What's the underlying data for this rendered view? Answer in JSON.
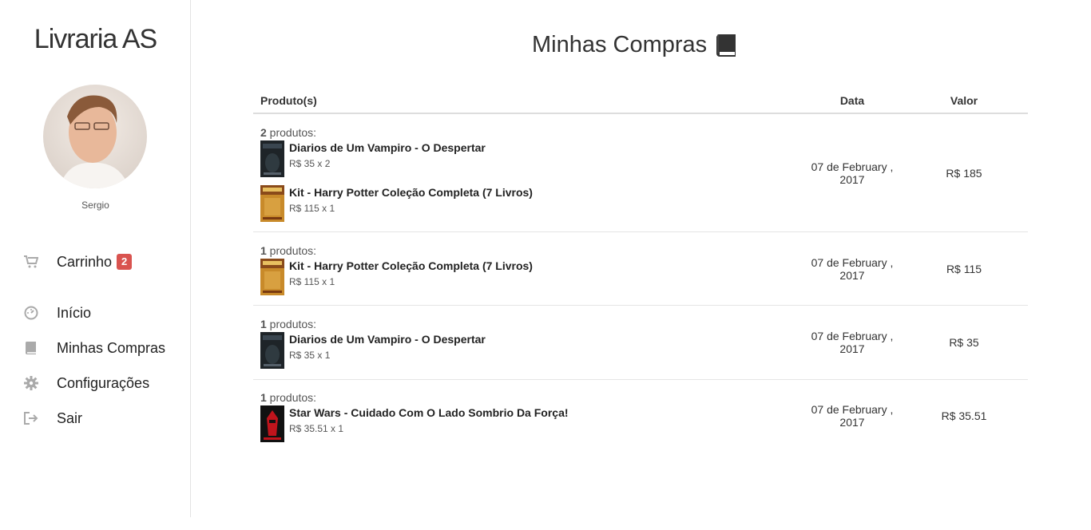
{
  "sidebar": {
    "brand": "Livraria AS",
    "username": "Sergio",
    "cart": {
      "label": "Carrinho",
      "badge": "2"
    },
    "items": [
      {
        "label": "Início",
        "icon": "dashboard-icon"
      },
      {
        "label": "Minhas Compras",
        "icon": "book-icon"
      },
      {
        "label": "Configurações",
        "icon": "gear-icon"
      },
      {
        "label": "Sair",
        "icon": "logout-icon"
      }
    ]
  },
  "main": {
    "title": "Minhas Compras",
    "title_icon": "book-icon",
    "columns": {
      "products": "Produto(s)",
      "date": "Data",
      "value": "Valor"
    },
    "orders": [
      {
        "count": "2",
        "count_suffix": " produtos:",
        "date": "07 de February , 2017",
        "value": "R$ 185",
        "items": [
          {
            "name": "Diarios de Um Vampiro - O Despertar",
            "price": "R$ 35 x 2",
            "cover": "vampire"
          },
          {
            "name": "Kit - Harry Potter Coleção Completa (7 Livros)",
            "price": "R$ 115 x 1",
            "cover": "hp"
          }
        ]
      },
      {
        "count": "1",
        "count_suffix": " produtos:",
        "date": "07 de February , 2017",
        "value": "R$ 115",
        "items": [
          {
            "name": "Kit - Harry Potter Coleção Completa (7 Livros)",
            "price": "R$ 115 x 1",
            "cover": "hp"
          }
        ]
      },
      {
        "count": "1",
        "count_suffix": " produtos:",
        "date": "07 de February , 2017",
        "value": "R$ 35",
        "items": [
          {
            "name": "Diarios de Um Vampiro - O Despertar",
            "price": "R$ 35 x 1",
            "cover": "vampire"
          }
        ]
      },
      {
        "count": "1",
        "count_suffix": " produtos:",
        "date": "07 de February , 2017",
        "value": "R$ 35.51",
        "items": [
          {
            "name": "Star Wars - Cuidado Com O Lado Sombrio Da Força!",
            "price": "R$ 35.51 x 1",
            "cover": "starwars"
          }
        ]
      }
    ]
  },
  "colors": {
    "badge": "#d9534f",
    "icon": "#aaaaaa"
  }
}
